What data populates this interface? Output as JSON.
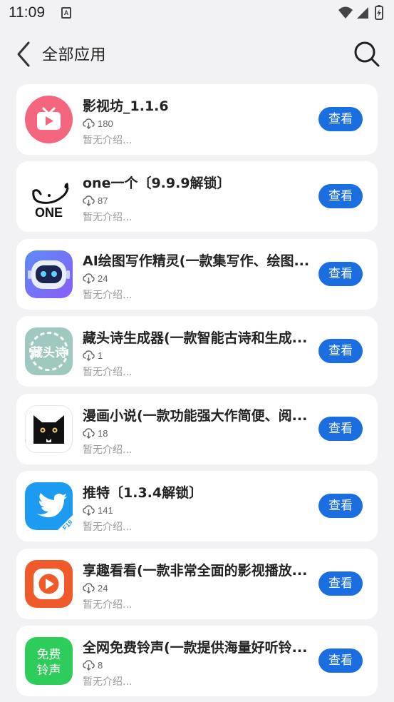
{
  "status": {
    "time": "11:09"
  },
  "header": {
    "title": "全部应用"
  },
  "items": [
    {
      "name": "影视坊_1.1.6",
      "downloads": "180",
      "desc": "暂无介绍...",
      "button": "查看",
      "icon": "tv-play-icon"
    },
    {
      "name": "one一个〔9.9.9解锁〕",
      "downloads": "87",
      "desc": "暂无介绍...",
      "button": "查看",
      "icon": "one-whale-logo-icon",
      "icon_text": "ONE"
    },
    {
      "name": "AI绘图写作精灵(一款集写作、绘图...",
      "downloads": "24",
      "desc": "暂无介绍...",
      "button": "查看",
      "icon": "robot-icon"
    },
    {
      "name": "藏头诗生成器(一款智能古诗和生成...",
      "downloads": "1",
      "desc": "暂无介绍...",
      "button": "查看",
      "icon": "poem-seal-icon",
      "icon_text": "藏头诗"
    },
    {
      "name": "漫画小说(一款功能强大作简便、阅...",
      "downloads": "18",
      "desc": "暂无介绍...",
      "button": "查看",
      "icon": "black-cat-icon"
    },
    {
      "name": "推特〔1.3.4解锁〕",
      "downloads": "141",
      "desc": "暂无介绍...",
      "button": "查看",
      "icon": "twitter-bird-icon",
      "icon_text": "F18"
    },
    {
      "name": "享趣看看(一款非常全面的影视播放...",
      "downloads": "24",
      "desc": "暂无介绍...",
      "button": "查看",
      "icon": "orange-play-icon"
    },
    {
      "name": "全网免费铃声(一款提供海量好听铃...",
      "downloads": "8",
      "desc": "暂无介绍...",
      "button": "查看",
      "icon": "ringtone-text-icon",
      "icon_text": "免费铃声"
    }
  ],
  "colors": {
    "accent": "#1a6ee0",
    "background": "#f2f2f4",
    "card": "#ffffff"
  }
}
